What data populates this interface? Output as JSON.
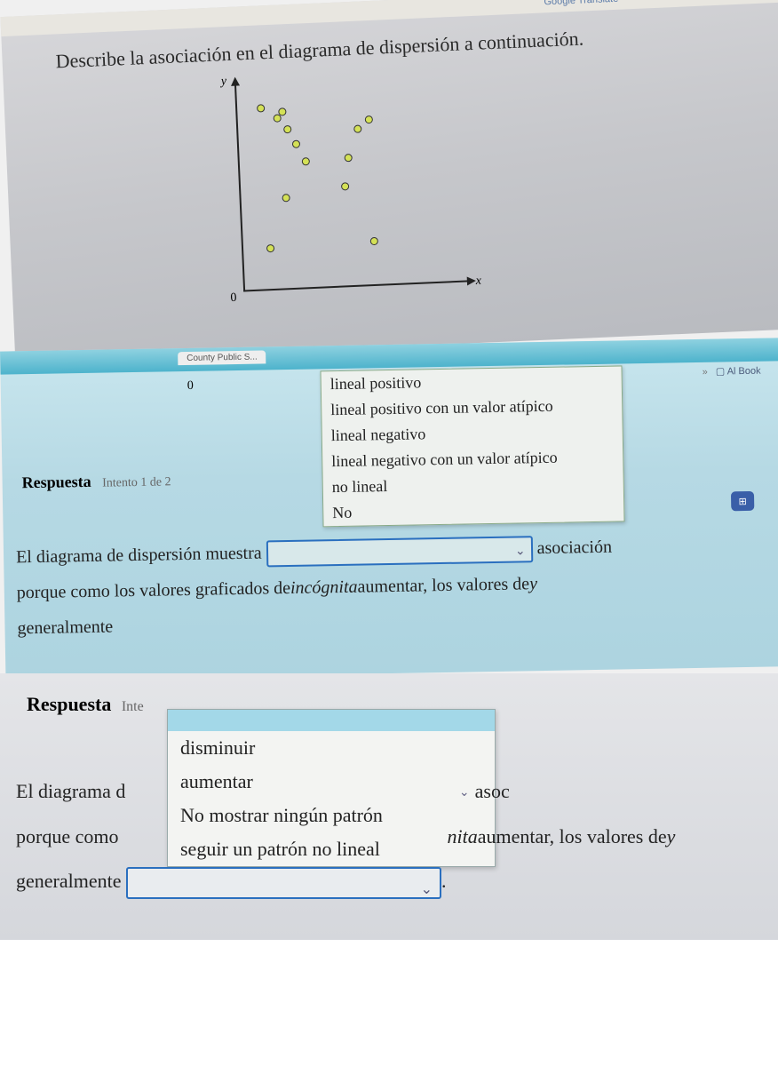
{
  "translate_hint": "Google Translate",
  "question": "Describe la asociación en el diagrama de dispersión a continuación.",
  "chart_data": {
    "type": "scatter",
    "title": "",
    "xlabel": "x",
    "ylabel": "y",
    "origin_label": "0",
    "xlim": [
      0,
      10
    ],
    "ylim": [
      0,
      10
    ],
    "points": [
      {
        "x": 1.0,
        "y": 8.7
      },
      {
        "x": 1.8,
        "y": 8.2
      },
      {
        "x": 2.0,
        "y": 8.5
      },
      {
        "x": 2.2,
        "y": 7.7
      },
      {
        "x": 2.6,
        "y": 7.0
      },
      {
        "x": 3.0,
        "y": 6.2
      },
      {
        "x": 2.0,
        "y": 4.5
      },
      {
        "x": 1.2,
        "y": 2.2
      },
      {
        "x": 5.5,
        "y": 7.6
      },
      {
        "x": 6.0,
        "y": 8.0
      },
      {
        "x": 5.0,
        "y": 6.3
      },
      {
        "x": 4.8,
        "y": 5.0
      },
      {
        "x": 6.0,
        "y": 2.3
      }
    ]
  },
  "tab_label": "County Public S...",
  "folder_label": "Al Book",
  "zero_label": "0",
  "response_label": "Respuesta",
  "attempt_label": "Intento 1 de 2",
  "attempt_label_short": "Inte",
  "dropdown1": {
    "options": [
      "lineal positivo",
      "lineal positivo con un valor atípico",
      "lineal negativo",
      "lineal negativo con un valor atípico",
      "no lineal",
      "No"
    ]
  },
  "sentence1": {
    "p1": "El diagrama de dispersión muestra",
    "p2": "asociación",
    "p3": "porque como los valores graficados de",
    "p3_italic": "incógnita",
    "p4": "aumentar, los valores de",
    "p4_italic": "y",
    "p5": "generalmente"
  },
  "dropdown2": {
    "options": [
      "disminuir",
      "aumentar",
      "No mostrar ningún patrón",
      "seguir un patrón no lineal"
    ]
  },
  "sentence3": {
    "p1": "El diagrama d",
    "asoc_chevron": "⌄",
    "asoc": "asoc",
    "p2": "porque como",
    "p2_italic": "nita",
    "p2b": "aumentar, los valores de",
    "p2b_italic": "y",
    "p3": "generalmente",
    "period": "."
  },
  "keypad_glyph": "⊞"
}
